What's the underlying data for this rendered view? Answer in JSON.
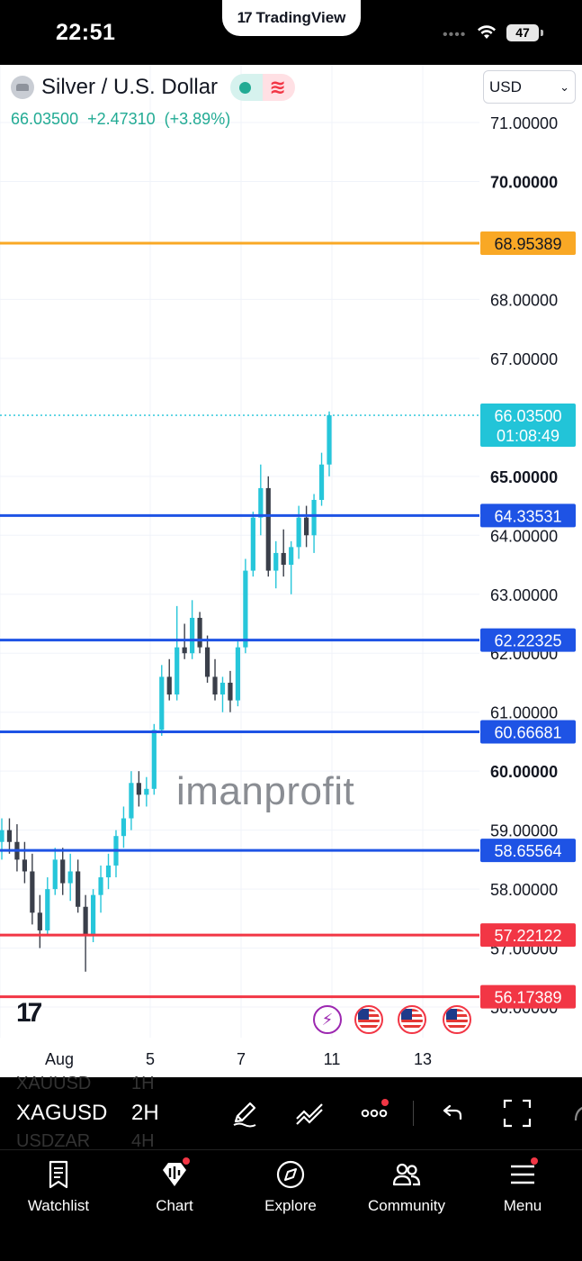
{
  "status_bar": {
    "time": "22:51",
    "brand_pill": "TradingView",
    "battery": "47"
  },
  "header": {
    "symbol_name": "Silver / U.S. Dollar",
    "last_price": "66.03500",
    "change": "+2.47310",
    "change_pct": "(+3.89%)",
    "currency": "USD"
  },
  "chart_data": {
    "type": "candlestick",
    "symbol": "XAGUSD",
    "interval": "2H",
    "y_axis": {
      "ticks": [
        "71.00000",
        "70.00000",
        "68.00000",
        "67.00000",
        "65.00000",
        "64.00000",
        "63.00000",
        "62.00000",
        "61.00000",
        "60.00000",
        "59.00000",
        "58.00000",
        "57.00000",
        "56.00000"
      ],
      "tick_values": [
        71,
        70,
        68,
        67,
        65,
        64,
        63,
        62,
        61,
        60,
        59,
        58,
        57,
        56
      ],
      "bold_ticks": [
        70,
        65,
        60
      ],
      "range": [
        55.6,
        71.3
      ]
    },
    "x_axis": {
      "ticks": [
        "Aug",
        "5",
        "7",
        "11",
        "13"
      ]
    },
    "horizontal_lines": [
      {
        "value": 68.95389,
        "label": "68.95389",
        "color": "#f9a825"
      },
      {
        "value": 64.33531,
        "label": "64.33531",
        "color": "#1e53e5"
      },
      {
        "value": 62.22325,
        "label": "62.22325",
        "color": "#1e53e5"
      },
      {
        "value": 60.66681,
        "label": "60.66681",
        "color": "#1e53e5"
      },
      {
        "value": 58.65564,
        "label": "58.65564",
        "color": "#1e53e5"
      },
      {
        "value": 57.22122,
        "label": "57.22122",
        "color": "#f23645"
      },
      {
        "value": 56.17389,
        "label": "56.17389",
        "color": "#f23645"
      }
    ],
    "last_price_marker": {
      "value": 66.035,
      "price": "66.03500",
      "countdown": "01:08:49",
      "color": "#22c4d8"
    },
    "candles": [
      [
        58.8,
        59.2,
        58.5,
        59.0
      ],
      [
        59.0,
        59.2,
        58.6,
        58.8
      ],
      [
        58.8,
        59.1,
        58.3,
        58.5
      ],
      [
        58.5,
        58.8,
        58.1,
        58.3
      ],
      [
        58.3,
        58.6,
        57.4,
        57.6
      ],
      [
        57.6,
        57.9,
        57.0,
        57.3
      ],
      [
        57.3,
        58.2,
        57.2,
        58.0
      ],
      [
        58.0,
        58.7,
        57.9,
        58.5
      ],
      [
        58.5,
        58.7,
        57.9,
        58.1
      ],
      [
        58.1,
        58.6,
        57.8,
        58.3
      ],
      [
        58.3,
        58.5,
        57.6,
        57.7
      ],
      [
        57.7,
        57.9,
        56.6,
        57.2
      ],
      [
        57.2,
        58.0,
        57.1,
        57.9
      ],
      [
        57.9,
        58.4,
        57.6,
        58.2
      ],
      [
        58.2,
        58.6,
        58.0,
        58.4
      ],
      [
        58.4,
        59.0,
        58.2,
        58.9
      ],
      [
        58.9,
        59.4,
        58.7,
        59.2
      ],
      [
        59.2,
        60.0,
        59.0,
        59.8
      ],
      [
        59.8,
        60.0,
        59.4,
        59.6
      ],
      [
        59.6,
        59.9,
        59.4,
        59.7
      ],
      [
        59.7,
        60.8,
        59.6,
        60.7
      ],
      [
        60.7,
        61.8,
        60.6,
        61.6
      ],
      [
        61.6,
        61.9,
        61.2,
        61.3
      ],
      [
        61.3,
        62.8,
        61.2,
        62.1
      ],
      [
        62.1,
        62.5,
        61.9,
        62.0
      ],
      [
        62.0,
        62.9,
        61.9,
        62.6
      ],
      [
        62.6,
        62.7,
        62.0,
        62.1
      ],
      [
        62.1,
        62.3,
        61.5,
        61.6
      ],
      [
        61.6,
        61.9,
        61.2,
        61.3
      ],
      [
        61.3,
        61.6,
        61.0,
        61.5
      ],
      [
        61.5,
        61.7,
        61.0,
        61.2
      ],
      [
        61.2,
        62.2,
        61.1,
        62.1
      ],
      [
        62.1,
        63.6,
        62.0,
        63.4
      ],
      [
        63.4,
        64.4,
        63.3,
        64.3
      ],
      [
        64.3,
        65.2,
        64.0,
        64.8
      ],
      [
        64.8,
        65.0,
        63.3,
        63.4
      ],
      [
        63.4,
        63.9,
        63.1,
        63.7
      ],
      [
        63.7,
        64.1,
        63.3,
        63.5
      ],
      [
        63.5,
        63.9,
        63.0,
        63.8
      ],
      [
        63.8,
        64.5,
        63.6,
        64.3
      ],
      [
        64.3,
        64.5,
        63.8,
        64.0
      ],
      [
        64.0,
        64.7,
        63.7,
        64.6
      ],
      [
        64.6,
        65.4,
        64.5,
        65.2
      ],
      [
        65.2,
        66.1,
        65.0,
        66.035
      ]
    ]
  },
  "chart_overlay": {
    "watermark": "imanprofit"
  },
  "toolbar": {
    "symbol_ghost_above": "XAUUSD",
    "symbol_current": "XAGUSD",
    "symbol_ghost_below": "USDZAR",
    "tf_ghost_above": "1H",
    "tf_current": "2H",
    "tf_ghost_below": "4H"
  },
  "bottom_nav": {
    "items": [
      {
        "label": "Watchlist",
        "icon": "watchlist-icon"
      },
      {
        "label": "Chart",
        "icon": "chart-icon"
      },
      {
        "label": "Explore",
        "icon": "compass-icon"
      },
      {
        "label": "Community",
        "icon": "community-icon"
      },
      {
        "label": "Menu",
        "icon": "menu-icon"
      }
    ]
  }
}
